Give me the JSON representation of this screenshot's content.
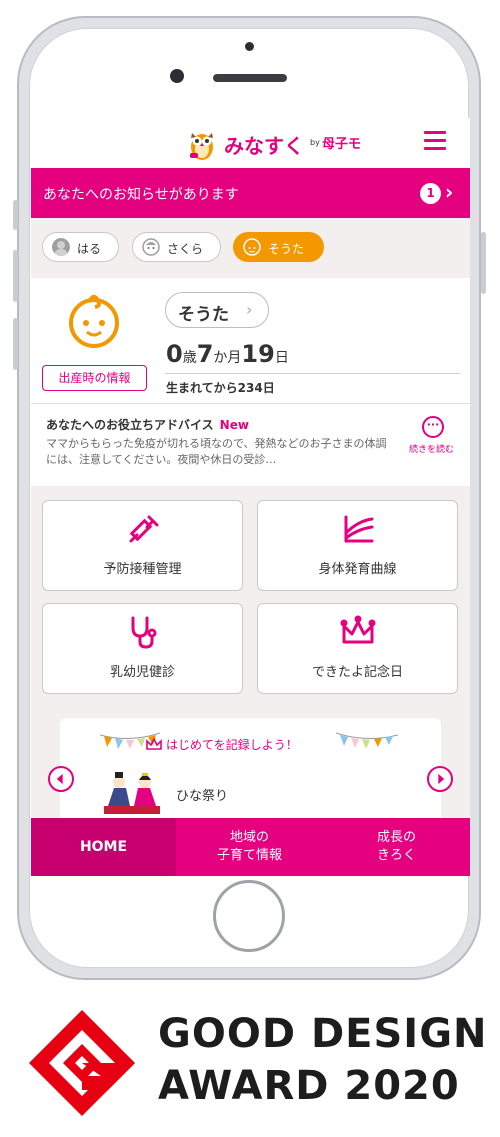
{
  "app": {
    "logo_text": "みなすく",
    "logo_by": "by",
    "logo_sub": "母子モ"
  },
  "notice": {
    "text": "あなたへのお知らせがあります",
    "count": "1"
  },
  "children": [
    {
      "name": "はる",
      "active": false
    },
    {
      "name": "さくら",
      "active": false
    },
    {
      "name": "そうた",
      "active": true
    }
  ],
  "profile": {
    "birth_info_label": "出産時の情報",
    "name": "そうた",
    "age_years": "0",
    "age_years_unit": "歳",
    "age_months": "7",
    "age_months_unit": "か月",
    "age_days": "19",
    "age_days_unit": "日",
    "since_birth": "生まれてから234日"
  },
  "advice": {
    "title": "あなたへのお役立ちアドバイス",
    "badge": "New",
    "body": "ママからもらった免疫が切れる頃なので、発熱などのお子さまの体調には、注意してください。夜間や休日の受診…",
    "more_label": "続きを読む"
  },
  "menu": [
    {
      "label": "予防接種管理",
      "icon": "syringe-icon"
    },
    {
      "label": "身体発育曲線",
      "icon": "growth-chart-icon"
    },
    {
      "label": "乳幼児健診",
      "icon": "stethoscope-icon"
    },
    {
      "label": "できたよ記念日",
      "icon": "crown-icon"
    }
  ],
  "banner": {
    "title": "はじめてを記録しよう！",
    "item": "ひな祭り"
  },
  "bottom_nav": {
    "home": "HOME",
    "local_line1": "地域の",
    "local_line2": "子育て情報",
    "growth_line1": "成長の",
    "growth_line2": "きろく"
  },
  "award": {
    "line1": "GOOD DESIGN",
    "line2": "AWARD 2020"
  },
  "colors": {
    "brand_pink": "#e4007f",
    "active_orange": "#f39800"
  }
}
